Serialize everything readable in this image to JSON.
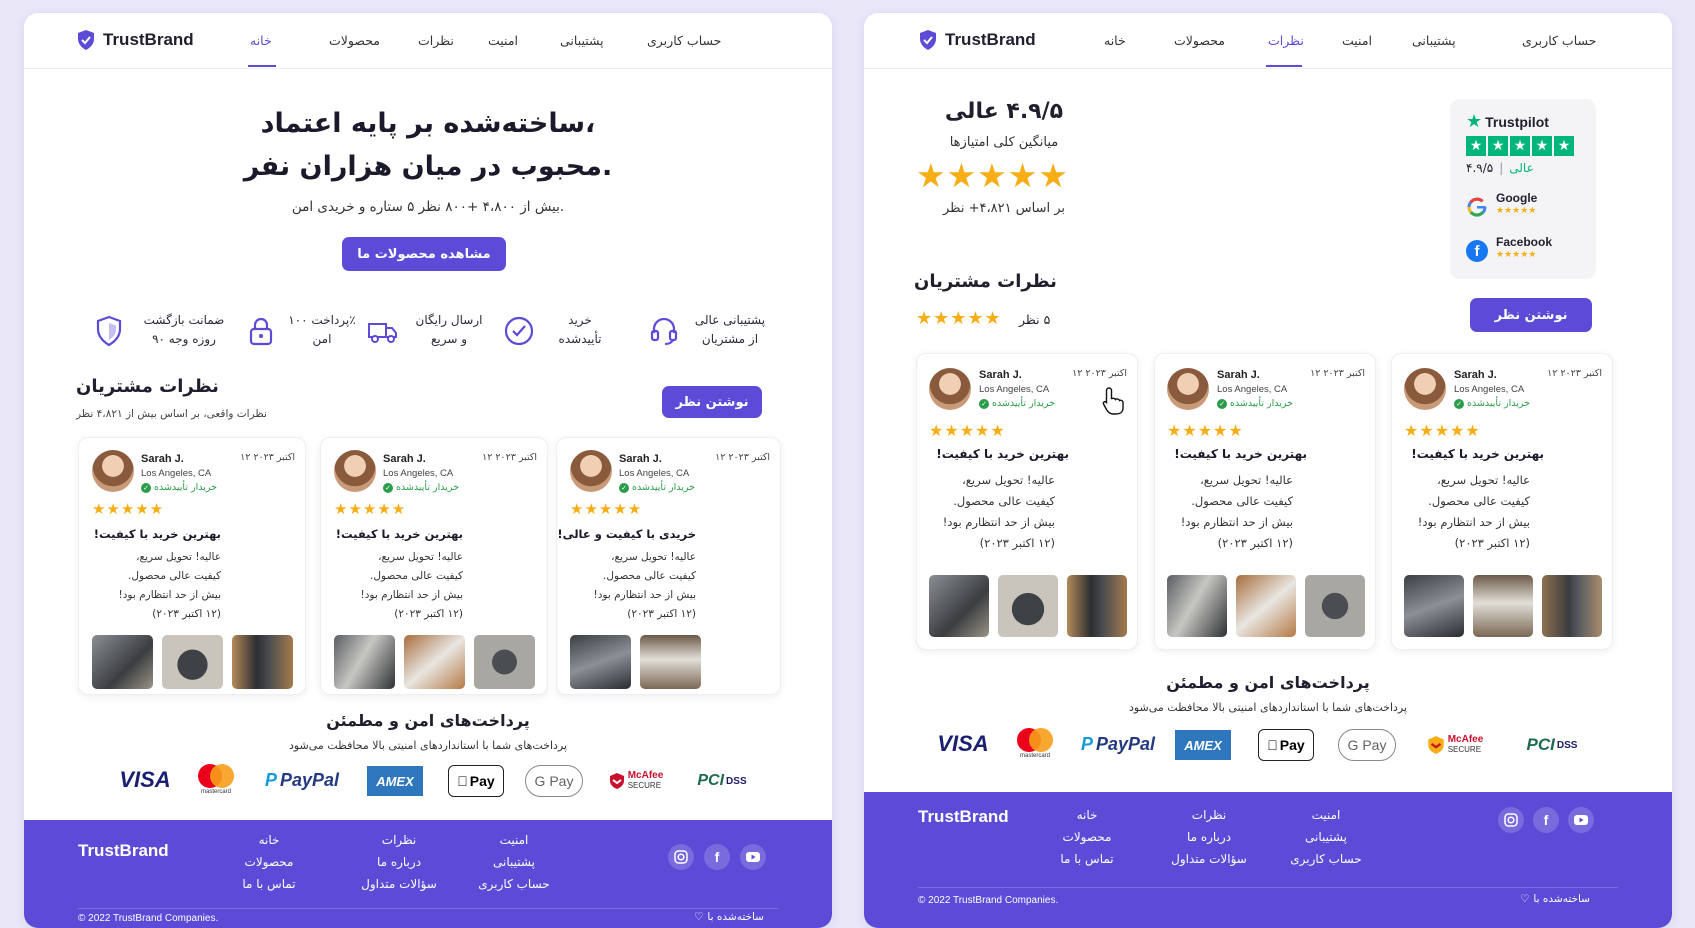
{
  "brand": "TrustBrand",
  "nav": {
    "account": "حساب کاربری",
    "support": "پشتیبانی",
    "security": "امنیت",
    "reviews": "نظرات",
    "products": "محصولات",
    "home": "خانه"
  },
  "left": {
    "hero_line1": "ساخته‌شده بر پایه اعتماد،",
    "hero_line2": "محبوب در میان هزاران نفر.",
    "hero_sub": "بیش از ۴،۸۰۰ +۸۰۰ نظر ۵ ستاره و خریدی امن.",
    "cta": "مشاهده محصولات ما",
    "features": [
      {
        "line1": "پشتیبانی عالی",
        "line2": "از مشتریان",
        "icon": "headset-icon"
      },
      {
        "line1": "خرید",
        "line2": "تأییدشده",
        "icon": "check-circle-icon"
      },
      {
        "line1": "ارسال رایگان",
        "line2": "و سریع",
        "icon": "truck-icon"
      },
      {
        "line1": "پرداخت ۱۰۰٪",
        "line2": "امن",
        "icon": "lock-icon"
      },
      {
        "line1": "ضمانت بازگشت",
        "line2": "۹۰ روزه وجه",
        "icon": "shield-icon"
      }
    ],
    "reviews_title": "نظرات مشتریان",
    "reviews_sub": "نظرات واقعی، بر اساس بیش از ۴،۸۲۱ نظر",
    "write_review": "نوشتن نظر"
  },
  "right": {
    "rating_title": "۴.۹/۵ عالی",
    "rating_avg": "میانگین کلی امتیازها",
    "rating_based": "بر اساس ۴،۸۲۱+ نظر",
    "reviews_title": "نظرات مشتریان",
    "five_count": "۵ نظر",
    "write_review": "نوشتن نظر",
    "trust": {
      "trustpilot": "Trustpilot",
      "tp_score": "۴.۹/۵",
      "tp_label": "عالی",
      "google": "Google",
      "facebook": "Facebook"
    }
  },
  "review": {
    "name": "Sarah J.",
    "location": "Los Angeles, CA",
    "verified": "خریدار تأییدشده",
    "date": "۱۲ اکتبر ۲۰۲۳",
    "stars": "★★★★★",
    "title_a": "بهترین خرید با کیفیت!",
    "title_b": "خریدی با کیفیت و عالی!",
    "body1": "عالیه! تحویل سریع،",
    "body2": "کیفیت عالی محصول.",
    "body3": "بیش از حد انتظارم بود!",
    "body4": "(۱۲ اکتبر ۲۰۲۳)"
  },
  "payments": {
    "title": "پرداخت‌های امن و مطمئن",
    "sub": "پرداخت‌های شما با استانداردهای امنیتی بالا محافظت می‌شود",
    "visa": "VISA",
    "mastercard": "mastercard",
    "paypal": "PayPal",
    "amex": "AMEX",
    "applepay": "Pay",
    "gpay": "G Pay",
    "mcafee": "McAfee",
    "mcafee_sub": "SECURE",
    "pci": "PCI",
    "dss": "DSS"
  },
  "footer": {
    "brand": "TrustBrand",
    "col1": [
      "خانه",
      "محصولات",
      "تماس با ما"
    ],
    "col2": [
      "نظرات",
      "درباره ما",
      "سؤالات متداول"
    ],
    "col3": [
      "امنیت",
      "پشتیبانی",
      "حساب کاربری"
    ],
    "copyright": "© 2022 TrustBrand Companies.",
    "made_with": "ساخته‌شده با"
  },
  "colors": {
    "accent": "#5b4bd6",
    "star": "#f6ad16",
    "verified": "#2a9d4a",
    "trustpilot": "#00b67a"
  }
}
